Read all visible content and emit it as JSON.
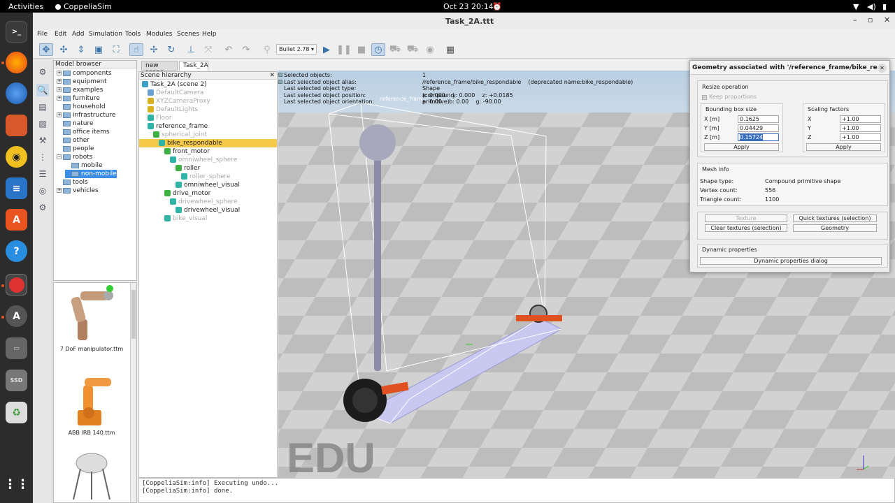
{
  "topbar": {
    "activities": "Activities",
    "app": "CoppeliaSim",
    "datetime": "Oct 23  20:14"
  },
  "window": {
    "title": "Task_2A.ttt"
  },
  "menu": [
    "File",
    "Edit",
    "Add",
    "Simulation",
    "Tools",
    "Modules",
    "Scenes",
    "Help"
  ],
  "toolbar": {
    "engine": "Bullet 2.78"
  },
  "model_browser": {
    "header": "Model browser",
    "items": [
      {
        "label": "components",
        "indent": 0,
        "expander": "+"
      },
      {
        "label": "equipment",
        "indent": 0,
        "expander": "+"
      },
      {
        "label": "examples",
        "indent": 0,
        "expander": "+"
      },
      {
        "label": "furniture",
        "indent": 0,
        "expander": "+"
      },
      {
        "label": "household",
        "indent": 0,
        "expander": ""
      },
      {
        "label": "infrastructure",
        "indent": 0,
        "expander": "+"
      },
      {
        "label": "nature",
        "indent": 0,
        "expander": ""
      },
      {
        "label": "office items",
        "indent": 0,
        "expander": ""
      },
      {
        "label": "other",
        "indent": 0,
        "expander": ""
      },
      {
        "label": "people",
        "indent": 0,
        "expander": ""
      },
      {
        "label": "robots",
        "indent": 0,
        "expander": "−"
      },
      {
        "label": "mobile",
        "indent": 1,
        "expander": ""
      },
      {
        "label": "non-mobile",
        "indent": 1,
        "expander": "",
        "selected": true
      },
      {
        "label": "tools",
        "indent": 0,
        "expander": ""
      },
      {
        "label": "vehicles",
        "indent": 0,
        "expander": "+"
      }
    ]
  },
  "thumbnails": [
    "7 DoF manipulator.ttm",
    "ABB IRB 140.ttm"
  ],
  "tabs": [
    "new scene",
    "Task_2A"
  ],
  "hierarchy": {
    "header": "Scene hierarchy",
    "items": [
      {
        "label": "Task_2A (scene 2)",
        "indent": 0,
        "grey": false,
        "color": "#3aa0c8"
      },
      {
        "label": "DefaultCamera",
        "indent": 1,
        "grey": true,
        "color": "#6aa0d0"
      },
      {
        "label": "XYZCameraProxy",
        "indent": 1,
        "grey": true,
        "color": "#d8b020"
      },
      {
        "label": "DefaultLights",
        "indent": 1,
        "grey": true,
        "color": "#d8b020"
      },
      {
        "label": "Floor",
        "indent": 1,
        "grey": true,
        "color": "#2fb5a8"
      },
      {
        "label": "reference_frame",
        "indent": 1,
        "grey": false,
        "color": "#2fb5a8"
      },
      {
        "label": "spherical_joint",
        "indent": 2,
        "grey": true,
        "color": "#3cb040"
      },
      {
        "label": "bike_respondable",
        "indent": 3,
        "grey": false,
        "color": "#2fb5a8",
        "selected": true
      },
      {
        "label": "front_motor",
        "indent": 4,
        "grey": false,
        "color": "#3cb040"
      },
      {
        "label": "omniwheel_sphere",
        "indent": 5,
        "grey": true,
        "color": "#2fb5a8"
      },
      {
        "label": "roller",
        "indent": 6,
        "grey": false,
        "color": "#3cb040"
      },
      {
        "label": "roller_sphere",
        "indent": 7,
        "grey": true,
        "color": "#2fb5a8"
      },
      {
        "label": "omniwheel_visual",
        "indent": 6,
        "grey": false,
        "color": "#2fb5a8"
      },
      {
        "label": "drive_motor",
        "indent": 4,
        "grey": false,
        "color": "#3cb040"
      },
      {
        "label": "drivewheel_sphere",
        "indent": 5,
        "grey": true,
        "color": "#2fb5a8"
      },
      {
        "label": "drivewheel_visual",
        "indent": 6,
        "grey": false,
        "color": "#2fb5a8"
      },
      {
        "label": "bike_visual",
        "indent": 4,
        "grey": true,
        "color": "#2fb5a8"
      }
    ]
  },
  "info": {
    "selected_label": "Selected objects:",
    "selected_value": "1",
    "alias_label": "Last selected object alias:",
    "alias_value": "/reference_frame/bike_respondable    (deprecated name:bike_respondable)",
    "type_label": "Last selected object type:",
    "type_value": "Shape (compound primitive)",
    "position_label": "Last selected object position:",
    "position_value": "x: 0.000    y: 0.000    z: +0.0185",
    "orientation_label": "Last selected object orientation:",
    "orientation_value": "a: 0.00    b: 0.00    g: -90.00"
  },
  "viewport": {
    "watermark": "EDU",
    "frame_label": "reference_fram"
  },
  "console": [
    "[CoppeliaSim:info] Executing undo...",
    "[CoppeliaSim:info] done."
  ],
  "dialog": {
    "title": "Geometry associated with '/reference_frame/bike_re...",
    "resize_header": "Resize operation",
    "keep_proportions": "Keep proportions",
    "bbox_header": "Bounding box size",
    "scale_header": "Scaling factors",
    "x_label": "X [m]",
    "y_label": "Y [m]",
    "z_label": "Z [m]",
    "x_value": "0.1625",
    "y_value": "0.04429",
    "z_value": "0.15724",
    "sx_label": "X",
    "sy_label": "Y",
    "sz_label": "Z",
    "sx_value": "+1.00",
    "sy_value": "+1.00",
    "sz_value": "+1.00",
    "apply": "Apply",
    "mesh_header": "Mesh info",
    "shape_type_label": "Shape type:",
    "shape_type_value": "Compound primitive shape",
    "vertex_label": "Vertex count:",
    "vertex_value": "556",
    "triangle_label": "Triangle count:",
    "triangle_value": "1100",
    "texture": "Texture",
    "quick_textures": "Quick textures (selection)",
    "clear_textures": "Clear textures (selection)",
    "geometry": "Geometry",
    "dynamic_header": "Dynamic properties",
    "dynamic_button": "Dynamic properties dialog"
  }
}
